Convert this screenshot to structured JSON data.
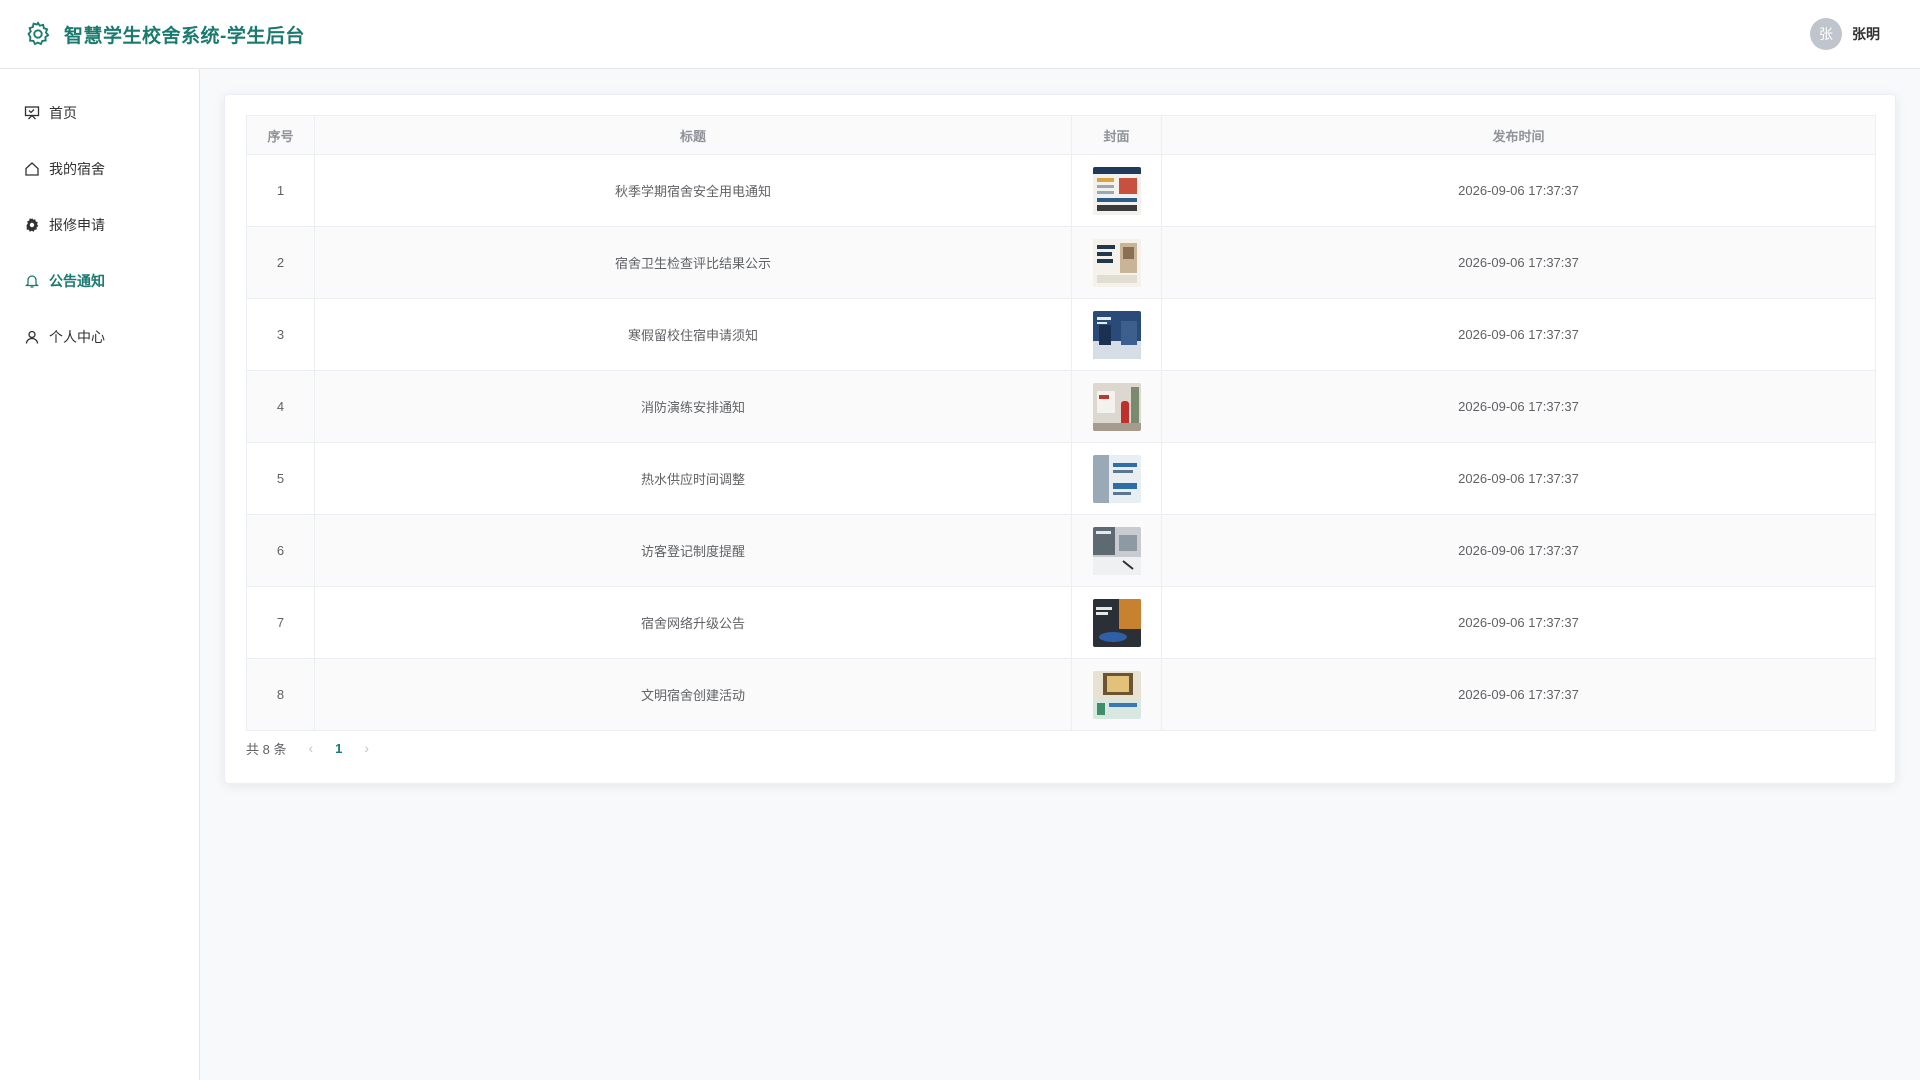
{
  "header": {
    "title": "智慧学生校舍系统-学生后台",
    "avatar_text": "张",
    "username": "张明",
    "brand_color": "#1a7a6e"
  },
  "sidebar": {
    "items": [
      {
        "label": "首页",
        "icon": "presentation-board-icon"
      },
      {
        "label": "我的宿舍",
        "icon": "home-icon"
      },
      {
        "label": "报修申请",
        "icon": "gear-icon"
      },
      {
        "label": "公告通知",
        "icon": "bell-icon",
        "active": true
      },
      {
        "label": "个人中心",
        "icon": "user-icon"
      }
    ]
  },
  "table": {
    "columns": [
      "序号",
      "标题",
      "封面",
      "发布时间"
    ],
    "rows": [
      {
        "index": "1",
        "title": "秋季学期宿舍安全用电通知",
        "time": "2026-09-06 17:37:37"
      },
      {
        "index": "2",
        "title": "宿舍卫生检查评比结果公示",
        "time": "2026-09-06 17:37:37"
      },
      {
        "index": "3",
        "title": "寒假留校住宿申请须知",
        "time": "2026-09-06 17:37:37"
      },
      {
        "index": "4",
        "title": "消防演练安排通知",
        "time": "2026-09-06 17:37:37"
      },
      {
        "index": "5",
        "title": "热水供应时间调整",
        "time": "2026-09-06 17:37:37"
      },
      {
        "index": "6",
        "title": "访客登记制度提醒",
        "time": "2026-09-06 17:37:37"
      },
      {
        "index": "7",
        "title": "宿舍网络升级公告",
        "time": "2026-09-06 17:37:37"
      },
      {
        "index": "8",
        "title": "文明宿舍创建活动",
        "time": "2026-09-06 17:37:37"
      }
    ]
  },
  "pagination": {
    "total_text": "共 8 条",
    "prev": "‹",
    "current_page": "1",
    "next": "›"
  }
}
